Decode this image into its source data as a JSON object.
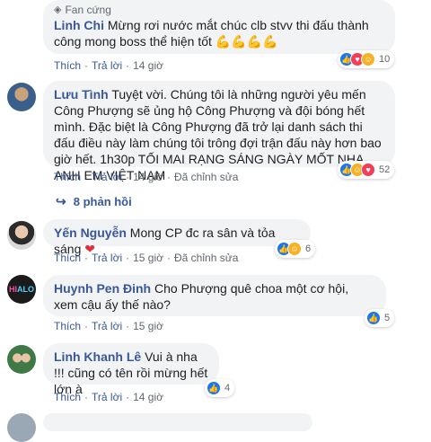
{
  "comments": [
    {
      "badge": "Fan cứng",
      "author": "Linh Chi",
      "text": "Mừng rơi nước mắt chúc clb stvv thi đấu thành công mong boss thể hiện tốt",
      "emoji": "💪💪💪💪",
      "actions": {
        "like": "Thích",
        "reply": "Trả lời",
        "time": "14 giờ"
      },
      "reaction_count": "10"
    },
    {
      "author": "Lưu Tình",
      "text": "Tuyệt vời. Chúng tôi là những người yêu mến Công Phượng sẽ ủng hộ Công Phượng và đội bóng hết mình. Đặc biệt là Công Phượng đã trở lại danh sách thi đấu điều này làm chúng tôi trông đợi trận đấu này hơn bao giờ hết. 1h30p TỐI MAI RẠNG SÁNG NGÀY MỐT NHA ANH EM VIỆT NAM",
      "actions": {
        "like": "Thích",
        "reply": "Trả lời",
        "time": "14 giờ",
        "edited": "Đã chỉnh sửa"
      },
      "reaction_count": "52",
      "replies_label": "8 phản hồi"
    },
    {
      "author": "Yến Nguyễn",
      "text": "Mong CP đc ra sân và tỏa sáng",
      "actions": {
        "like": "Thích",
        "reply": "Trả lời",
        "time": "15 giờ",
        "edited": "Đã chỉnh sửa"
      },
      "reaction_count": "6"
    },
    {
      "author": "Huynh Pen Đinh",
      "text": "Cho Phượng quê choa một cơ hội, xem cậu ấy thế nào?",
      "actions": {
        "like": "Thích",
        "reply": "Trả lời",
        "time": "15 giờ"
      },
      "reaction_count": "5"
    },
    {
      "author": "Linh Khanh Lê",
      "text": "Vui à nha !!! cũng có tên rồi mừng hết lớn à",
      "actions": {
        "like": "Thích",
        "reply": "Trả lời",
        "time": "14 giờ"
      },
      "reaction_count": "4"
    }
  ],
  "colors": {
    "link": "#385898",
    "bubble": "#f2f3f5",
    "like": "#1877f2",
    "love": "#f33e58",
    "haha": "#f7b125"
  }
}
